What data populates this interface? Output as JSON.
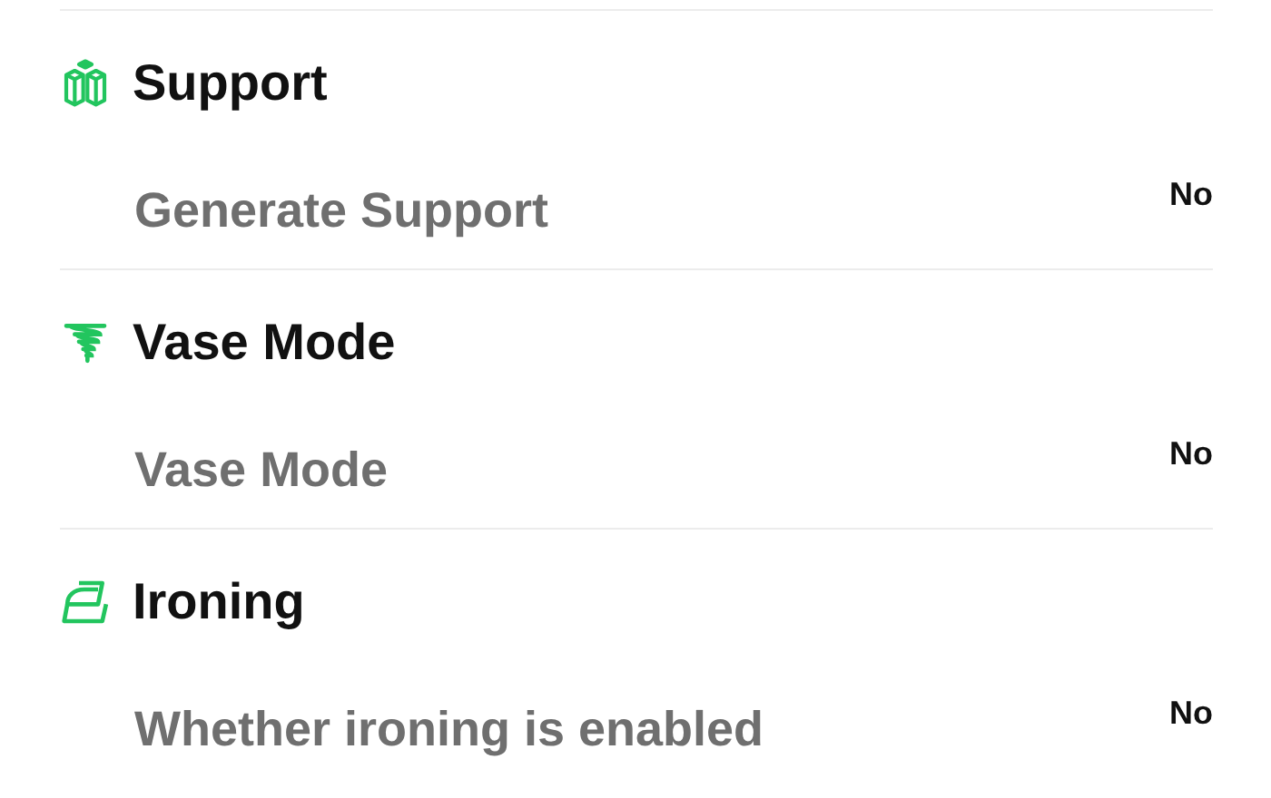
{
  "sections": [
    {
      "title": "Support",
      "rows": [
        {
          "label": "Generate Support",
          "value": "No"
        }
      ]
    },
    {
      "title": "Vase Mode",
      "rows": [
        {
          "label": "Vase Mode",
          "value": "No"
        }
      ]
    },
    {
      "title": "Ironing",
      "rows": [
        {
          "label": "Whether ironing is enabled",
          "value": "No"
        }
      ]
    }
  ]
}
